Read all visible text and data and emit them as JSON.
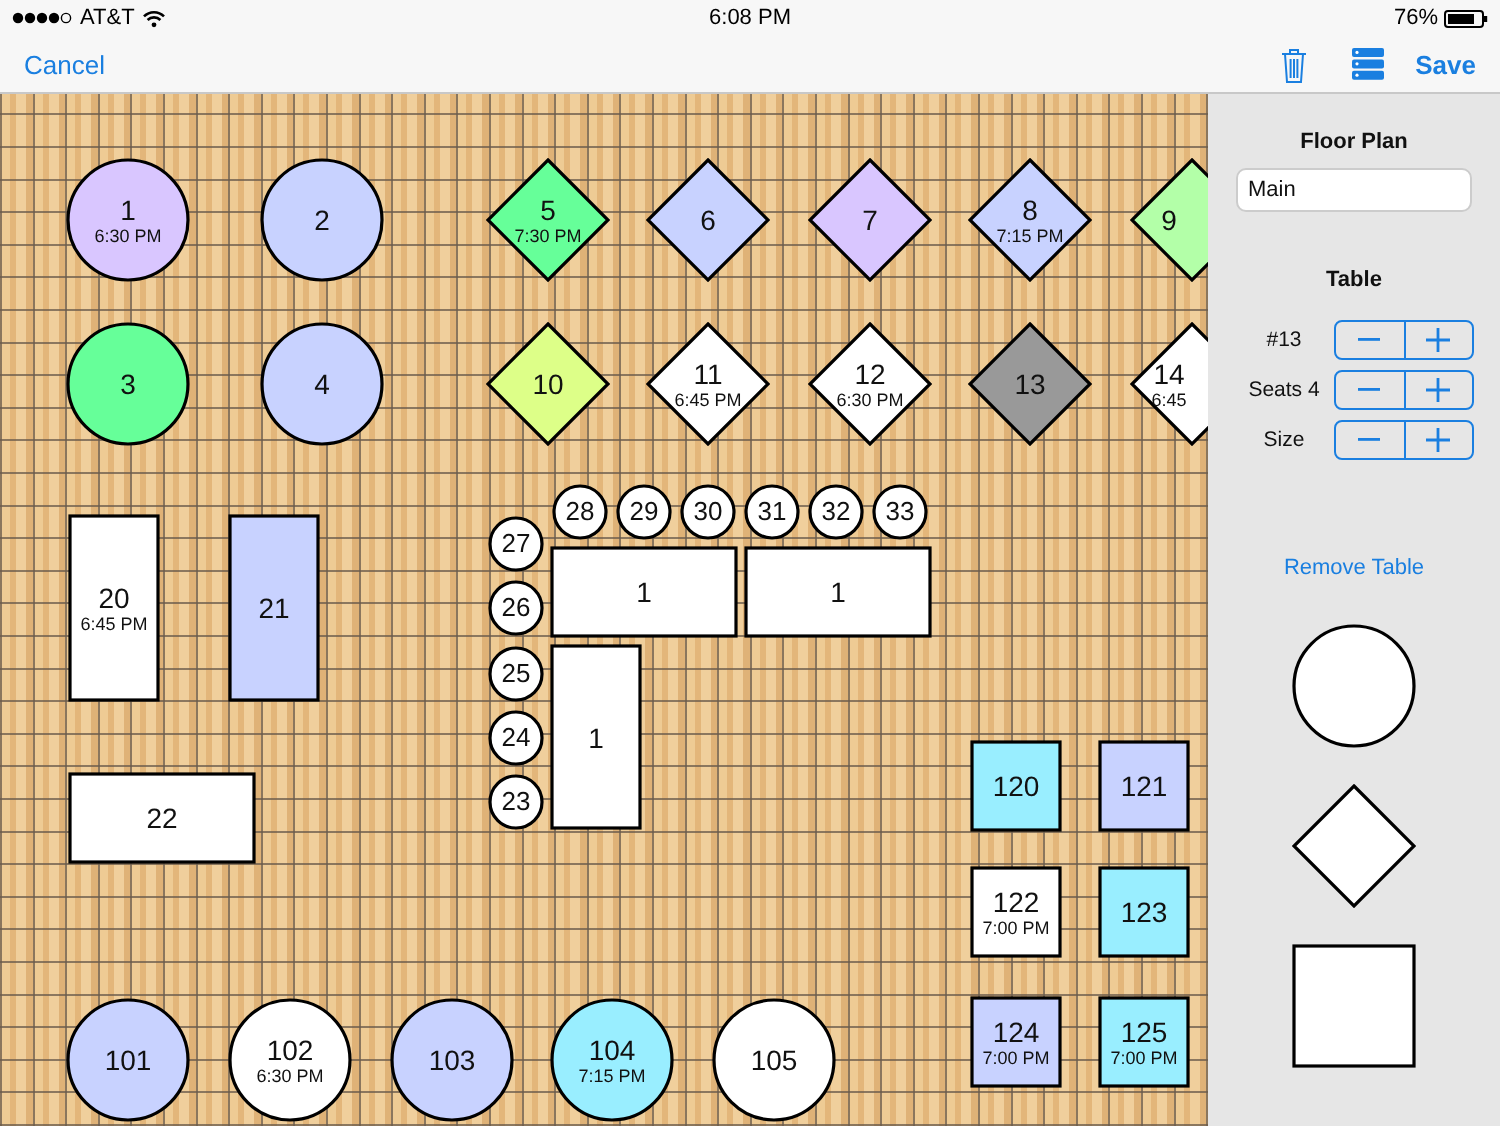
{
  "status_bar": {
    "carrier": "AT&T",
    "time": "6:08 PM",
    "battery": "76%"
  },
  "nav_bar": {
    "cancel": "Cancel",
    "save": "Save"
  },
  "floor": {
    "tables": [
      {
        "kind": "round",
        "number": "1",
        "time": "6:30 PM",
        "color": "#d9c6ff"
      },
      {
        "kind": "round",
        "number": "2",
        "color": "#c8d2ff"
      },
      {
        "kind": "diamond",
        "number": "5",
        "time": "7:30 PM",
        "color": "#66ff99"
      },
      {
        "kind": "diamond",
        "number": "6",
        "color": "#c8d2ff"
      },
      {
        "kind": "diamond",
        "number": "7",
        "color": "#d9c6ff"
      },
      {
        "kind": "diamond",
        "number": "8",
        "time": "7:15 PM",
        "color": "#c8d2ff"
      },
      {
        "kind": "diamond",
        "number": "9",
        "color": "#b3ffa8"
      },
      {
        "kind": "round",
        "number": "3",
        "color": "#66ff99"
      },
      {
        "kind": "round",
        "number": "4",
        "color": "#c8d2ff"
      },
      {
        "kind": "diamond",
        "number": "10",
        "color": "#ddff88"
      },
      {
        "kind": "diamond",
        "number": "11",
        "time": "6:45 PM",
        "color": "#ffffff"
      },
      {
        "kind": "diamond",
        "number": "12",
        "time": "6:30 PM",
        "color": "#ffffff"
      },
      {
        "kind": "diamond",
        "number": "13",
        "color": "#999999"
      },
      {
        "kind": "diamond",
        "number": "14",
        "time": "6:45",
        "color": "#ffffff"
      },
      {
        "kind": "round",
        "number": "28",
        "color": "#ffffff"
      },
      {
        "kind": "round",
        "number": "29",
        "color": "#ffffff"
      },
      {
        "kind": "round",
        "number": "30",
        "color": "#ffffff"
      },
      {
        "kind": "round",
        "number": "31",
        "color": "#ffffff"
      },
      {
        "kind": "round",
        "number": "32",
        "color": "#ffffff"
      },
      {
        "kind": "round",
        "number": "33",
        "color": "#ffffff"
      },
      {
        "kind": "rect",
        "number": "20",
        "time": "6:45 PM",
        "color": "#ffffff"
      },
      {
        "kind": "rect",
        "number": "21",
        "color": "#c8d2ff"
      },
      {
        "kind": "round",
        "number": "27",
        "color": "#ffffff"
      },
      {
        "kind": "rect",
        "number": "1",
        "color": "#ffffff"
      },
      {
        "kind": "rect",
        "number": "1",
        "color": "#ffffff"
      },
      {
        "kind": "round",
        "number": "26",
        "color": "#ffffff"
      },
      {
        "kind": "round",
        "number": "25",
        "color": "#ffffff"
      },
      {
        "kind": "rect",
        "number": "1",
        "color": "#ffffff"
      },
      {
        "kind": "round",
        "number": "24",
        "color": "#ffffff"
      },
      {
        "kind": "round",
        "number": "23",
        "color": "#ffffff"
      },
      {
        "kind": "rect",
        "number": "120",
        "color": "#99eeff"
      },
      {
        "kind": "rect",
        "number": "121",
        "color": "#c8d2ff"
      },
      {
        "kind": "rect",
        "number": "22",
        "color": "#ffffff"
      },
      {
        "kind": "rect",
        "number": "122",
        "time": "7:00 PM",
        "color": "#ffffff"
      },
      {
        "kind": "rect",
        "number": "123",
        "color": "#99eeff"
      },
      {
        "kind": "round",
        "number": "101",
        "color": "#c8d2ff"
      },
      {
        "kind": "round",
        "number": "102",
        "time": "6:30 PM",
        "color": "#ffffff"
      },
      {
        "kind": "round",
        "number": "103",
        "color": "#c8d2ff"
      },
      {
        "kind": "round",
        "number": "104",
        "time": "7:15 PM",
        "color": "#99eeff"
      },
      {
        "kind": "round",
        "number": "105",
        "color": "#ffffff"
      },
      {
        "kind": "rect",
        "number": "124",
        "time": "7:00 PM",
        "color": "#c8d2ff"
      },
      {
        "kind": "rect",
        "number": "125",
        "time": "7:00 PM",
        "color": "#99eeff"
      }
    ]
  },
  "sidebar": {
    "floor_plan_title": "Floor Plan",
    "floor_plan_name": {
      "value": "Main"
    },
    "table_title": "Table",
    "steppers": [
      {
        "label": "#13"
      },
      {
        "label": "Seats 4"
      },
      {
        "label": "Size"
      }
    ],
    "remove_link": "Remove Table",
    "palette": [
      {
        "kind": "round"
      },
      {
        "kind": "diamond"
      },
      {
        "kind": "rect"
      }
    ]
  }
}
